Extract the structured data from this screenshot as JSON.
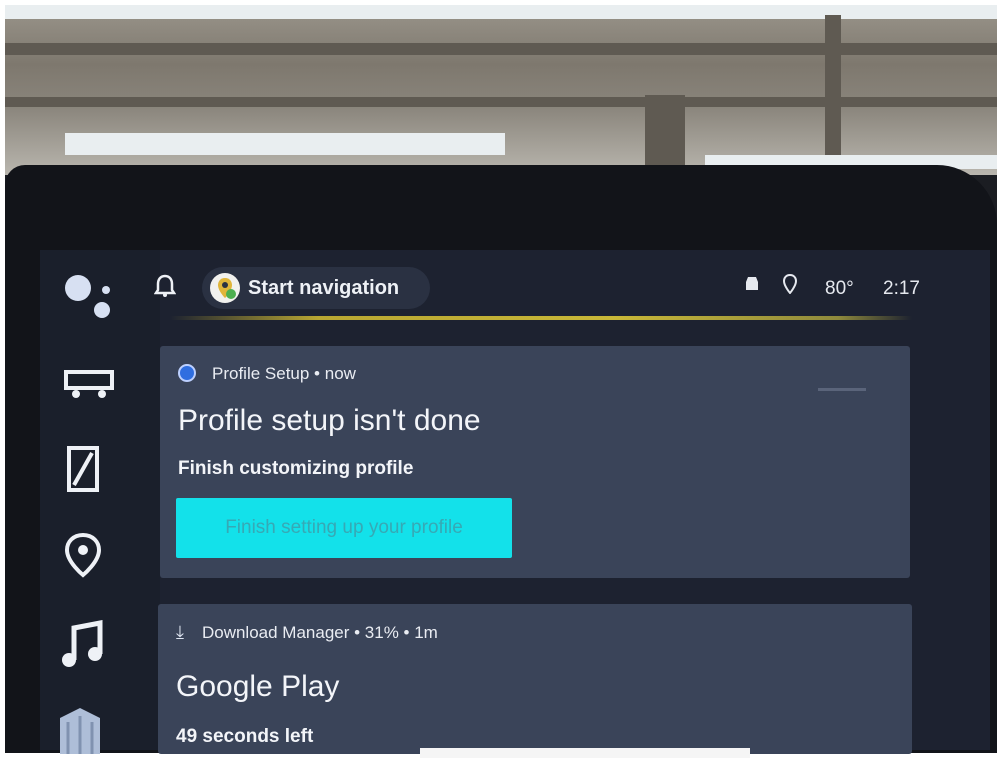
{
  "topbar": {
    "nav_label": "Start navigation",
    "temperature": "80°",
    "time": "2:17"
  },
  "rail": {
    "items": [
      {
        "icon": "assistant-icon"
      },
      {
        "icon": "vehicle-icon"
      },
      {
        "icon": "phone-icon"
      },
      {
        "icon": "location-pin-icon"
      },
      {
        "icon": "music-note-icon"
      },
      {
        "icon": "buildings-icon"
      }
    ]
  },
  "notifications": [
    {
      "header": "Profile Setup • now",
      "title": "Profile setup isn't done",
      "subtitle": "Finish customizing profile",
      "action": "Finish setting up your profile"
    },
    {
      "header": "Download Manager • 31% • 1m",
      "title": "Google Play",
      "subtitle": "49 seconds left",
      "progress": 0.31
    }
  ],
  "colors": {
    "accent_button": "#13e1ea",
    "card": "#3a4459",
    "screen": "#1d2230",
    "indicator": "#c9b838"
  }
}
